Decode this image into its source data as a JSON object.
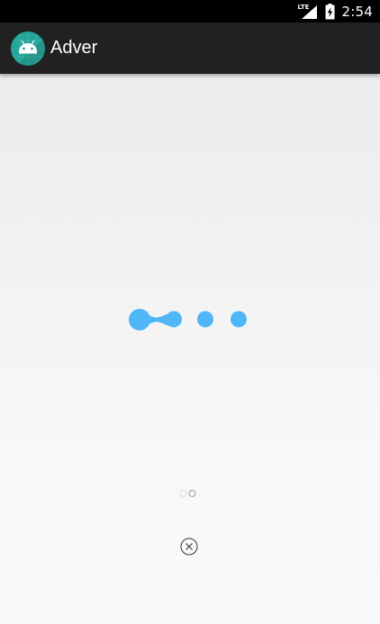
{
  "status_bar": {
    "network_label": "LTE",
    "time": "2:54",
    "icons": [
      "lte-signal-icon",
      "battery-charging-icon"
    ]
  },
  "app_bar": {
    "title": "Adver",
    "logo_icon": "android-icon"
  },
  "main": {
    "loading_indicator": "loading-dots-icon",
    "pager": {
      "count": 2,
      "active_index": 1
    },
    "close_icon": "close-circle-icon"
  },
  "colors": {
    "status_bar": "#000000",
    "app_bar": "#212121",
    "logo_background": "#26a69a",
    "loader_accent": "#4fb6f8",
    "background": "#fafafa"
  }
}
